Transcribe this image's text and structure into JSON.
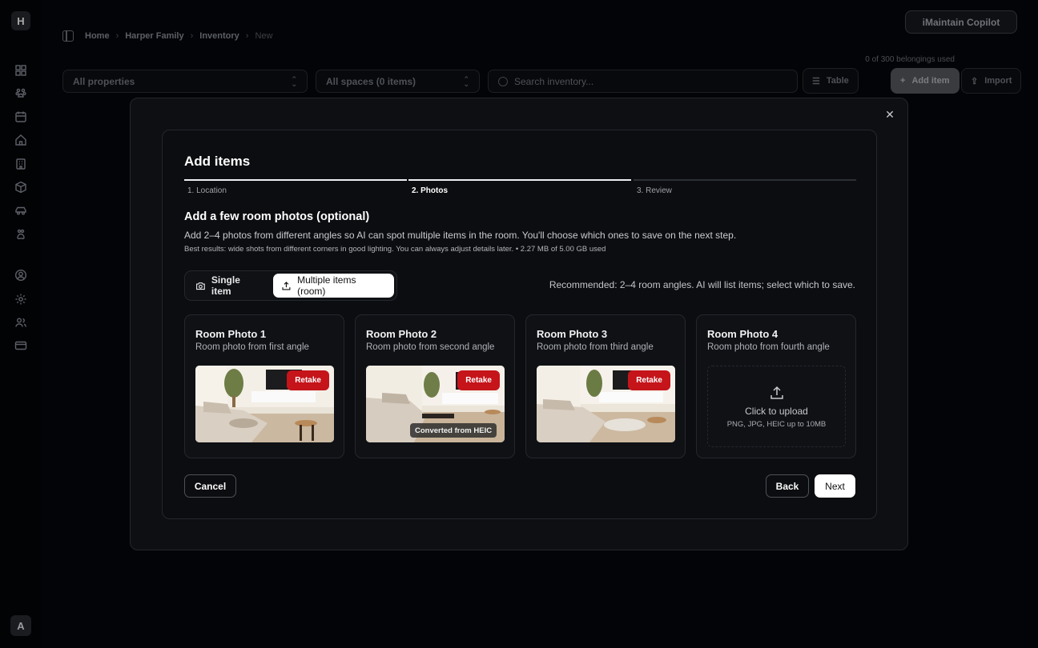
{
  "app": {
    "logo_letter": "H",
    "avatar_letter": "A",
    "breadcrumb": [
      "Home",
      "Harper Family",
      "Inventory",
      "New"
    ],
    "copilot_label": "iMaintain Copilot",
    "usage": "0 of 300 belongings used",
    "filters": {
      "properties": "All properties",
      "spaces": "All spaces (0 items)",
      "search_placeholder": "Search inventory..."
    },
    "toolbar": {
      "view_label": "Table",
      "add_label": "Add item",
      "import_label": "Import"
    },
    "rail_icons": [
      "dashboard-icon",
      "pets-icon",
      "calendar-icon",
      "home-icon",
      "building-icon",
      "box-icon",
      "car-icon",
      "paw-icon",
      "user-circle-icon",
      "settings-icon",
      "users-icon",
      "card-icon"
    ]
  },
  "modal": {
    "close_icon": "close-icon",
    "title": "Add items",
    "steps": [
      {
        "label": "1. Location",
        "state": "done"
      },
      {
        "label": "2. Photos",
        "state": "active"
      },
      {
        "label": "3. Review",
        "state": "pending"
      }
    ],
    "heading": "Add a few room photos (optional)",
    "description": "Add 2–4 photos from different angles so AI can spot multiple items in the room. You'll choose which ones to save on the next step.",
    "hint": "Best results: wide shots from different corners in good lighting. You can always adjust details later. • 2.27 MB of 5.00 GB used",
    "mode": {
      "single_label": "Single item",
      "multiple_label": "Multiple items (room)",
      "selected": "multiple"
    },
    "recommendation": "Recommended: 2–4 room angles. AI will list items; select which to save.",
    "photos": [
      {
        "title": "Room Photo 1",
        "subtitle": "Room photo from first angle",
        "retake_label": "Retake"
      },
      {
        "title": "Room Photo 2",
        "subtitle": "Room photo from second angle",
        "retake_label": "Retake",
        "badge": "Converted from HEIC"
      },
      {
        "title": "Room Photo 3",
        "subtitle": "Room photo from third angle",
        "retake_label": "Retake"
      },
      {
        "title": "Room Photo 4",
        "subtitle": "Room photo from fourth angle",
        "upload_label": "Click to upload",
        "upload_hint": "PNG, JPG, HEIC up to 10MB"
      }
    ],
    "buttons": {
      "cancel": "Cancel",
      "back": "Back",
      "next": "Next"
    },
    "colors": {
      "accent": "#c5141a",
      "step_active": "#eceef1",
      "surface": "#0d0f13"
    }
  }
}
